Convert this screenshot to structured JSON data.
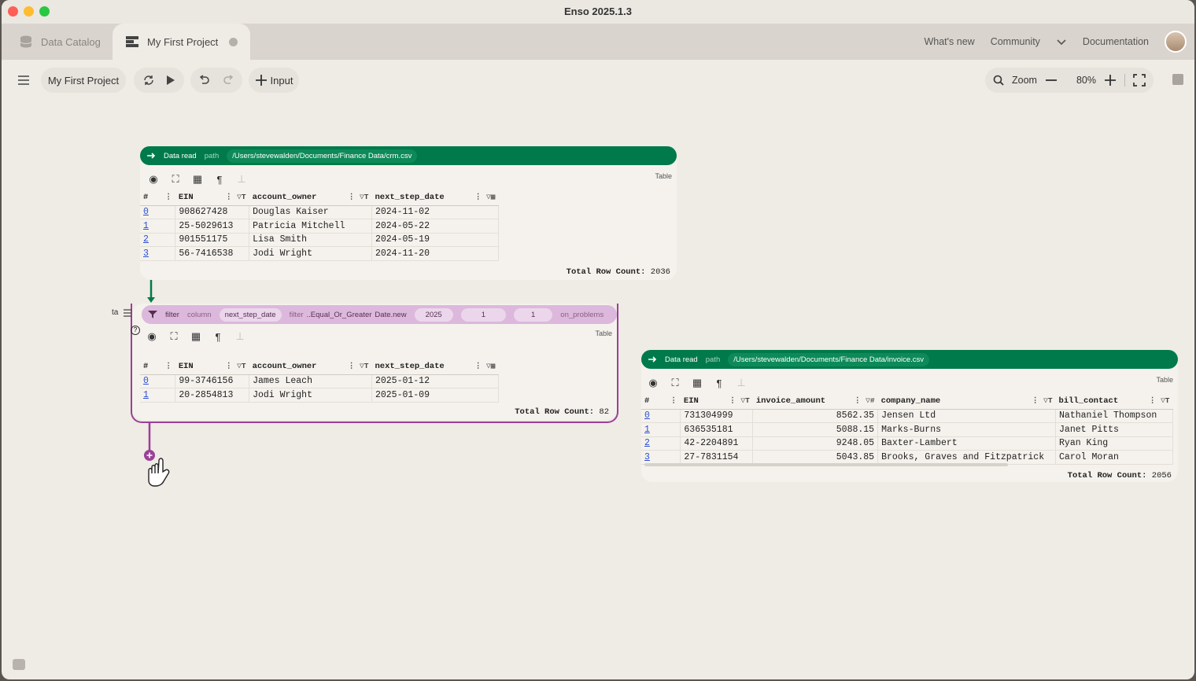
{
  "window": {
    "title": "Enso 2025.1.3"
  },
  "tabs": {
    "catalog": "Data Catalog",
    "project": "My First Project"
  },
  "topnav": {
    "whats_new": "What's new",
    "community": "Community",
    "documentation": "Documentation"
  },
  "toolbar": {
    "project_name": "My First Project",
    "input_label": "Input",
    "zoom_label": "Zoom",
    "zoom_value": "80%"
  },
  "node1": {
    "name": "Data read",
    "arg_label": "path",
    "path": "/Users/stevewalden/Documents/Finance Data/crm.csv",
    "viz_type": "Table",
    "columns": [
      "#",
      "EIN",
      "account_owner",
      "next_step_date"
    ],
    "rows": [
      [
        "0",
        "908627428",
        "Douglas Kaiser",
        "2024-11-02"
      ],
      [
        "1",
        "25-5029613",
        "Patricia Mitchell",
        "2024-05-22"
      ],
      [
        "2",
        "901551175",
        "Lisa Smith",
        "2024-05-19"
      ],
      [
        "3",
        "56-7416538",
        "Jodi Wright",
        "2024-11-20"
      ]
    ],
    "row_count_label": "Total Row Count:",
    "row_count": "2036"
  },
  "node2": {
    "name": "filter",
    "column_label": "column",
    "column_value": "next_step_date",
    "filter_label": "filter",
    "filter_value": "..Equal_Or_Greater",
    "date_fn": "Date.new",
    "year": "2025",
    "month": "1",
    "day": "1",
    "problems_label": "on_problems",
    "prefix": "ta",
    "viz_type": "Table",
    "columns": [
      "#",
      "EIN",
      "account_owner",
      "next_step_date"
    ],
    "rows": [
      [
        "0",
        "99-3746156",
        "James Leach",
        "2025-01-12"
      ],
      [
        "1",
        "20-2854813",
        "Jodi Wright",
        "2025-01-09"
      ]
    ],
    "row_count_label": "Total Row Count:",
    "row_count": "82"
  },
  "node3": {
    "name": "Data read",
    "arg_label": "path",
    "path": "/Users/stevewalden/Documents/Finance Data/invoice.csv",
    "viz_type": "Table",
    "columns": [
      "#",
      "EIN",
      "invoice_amount",
      "company_name",
      "bill_contact"
    ],
    "rows": [
      [
        "0",
        "731304999",
        "8562.35",
        "Jensen Ltd",
        "Nathaniel Thompson"
      ],
      [
        "1",
        "636535181",
        "5088.15",
        "Marks-Burns",
        "Janet Pitts"
      ],
      [
        "2",
        "42-2204891",
        "9248.05",
        "Baxter-Lambert",
        "Ryan King"
      ],
      [
        "3",
        "27-7831154",
        "5043.85",
        "Brooks, Graves and Fitzpatrick",
        "Carol Moran"
      ]
    ],
    "row_count_label": "Total Row Count:",
    "row_count": "2056"
  },
  "colors": {
    "data_node": "#007a4b",
    "filter_node": "#dcb8dc",
    "connector_purple": "#9b3f99",
    "link": "#2a4fd0"
  }
}
